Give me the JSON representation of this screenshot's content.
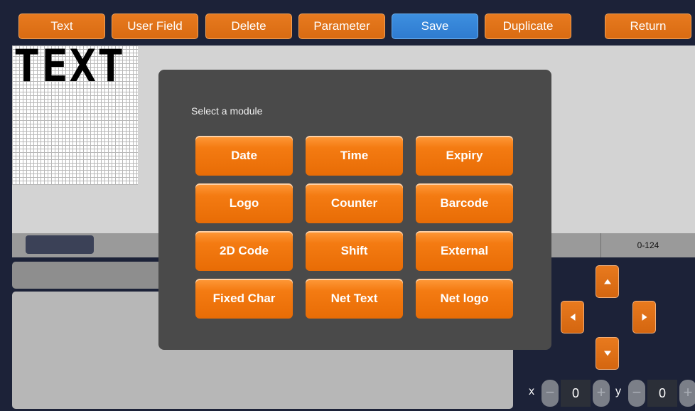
{
  "toolbar": {
    "text": "Text",
    "user_field": "User Field",
    "delete": "Delete",
    "parameter": "Parameter",
    "save": "Save",
    "duplicate": "Duplicate",
    "return": "Return"
  },
  "canvas": {
    "grid_text": "TEXT"
  },
  "status": {
    "range": "0-124"
  },
  "modal": {
    "title": "Select a module",
    "buttons": [
      "Date",
      "Time",
      "Expiry",
      "Logo",
      "Counter",
      "Barcode",
      "2D Code",
      "Shift",
      "External",
      "Fixed Char",
      "Net Text",
      "Net logo"
    ]
  },
  "position": {
    "x_label": "x",
    "y_label": "y",
    "x_value": "0",
    "y_value": "0",
    "minus": "−",
    "plus": "+"
  },
  "colors": {
    "accent_orange": "#e8700c",
    "save_blue": "#2f7bd0",
    "background": "#1c2238",
    "modal_bg": "#4a4a4a"
  }
}
